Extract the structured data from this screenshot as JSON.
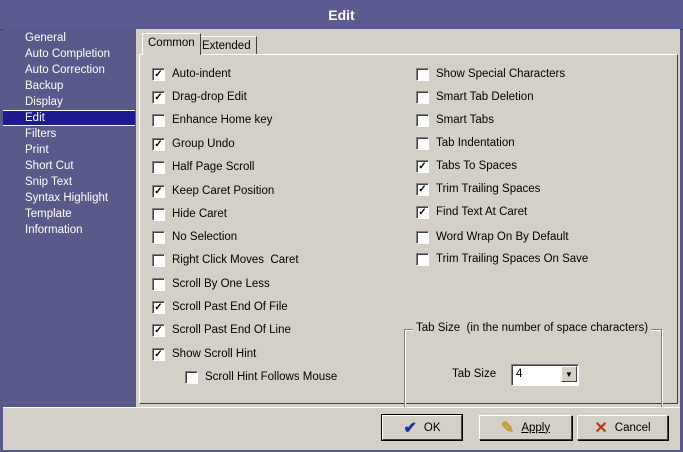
{
  "window": {
    "title": "Edit"
  },
  "sidebar": {
    "items": [
      {
        "label": "General"
      },
      {
        "label": "Auto Completion"
      },
      {
        "label": "Auto Correction"
      },
      {
        "label": "Backup"
      },
      {
        "label": "Display"
      },
      {
        "label": "Edit",
        "selected": true
      },
      {
        "label": "Filters"
      },
      {
        "label": "Print"
      },
      {
        "label": "Short Cut"
      },
      {
        "label": "Snip Text"
      },
      {
        "label": "Syntax Highlight"
      },
      {
        "label": "Template"
      },
      {
        "label": "Information"
      }
    ]
  },
  "tabs": {
    "common": "Common",
    "extended": "Extended",
    "active": "Common"
  },
  "left_options": [
    {
      "label": "Auto-indent",
      "checked": true
    },
    {
      "label": "Drag-drop Edit",
      "checked": true
    },
    {
      "label": "Enhance Home key",
      "checked": false
    },
    {
      "label": "Group Undo",
      "checked": true
    },
    {
      "label": "Half Page Scroll",
      "checked": false
    },
    {
      "label": "Keep Caret Position",
      "checked": true
    },
    {
      "label": "Hide Caret",
      "checked": false
    },
    {
      "label": "No Selection",
      "checked": false
    },
    {
      "label": "Right Click Moves  Caret",
      "checked": false
    },
    {
      "label": "Scroll By One Less",
      "checked": false
    },
    {
      "label": "Scroll Past End Of File",
      "checked": true
    },
    {
      "label": "Scroll Past End Of Line",
      "checked": true
    },
    {
      "label": "Show Scroll Hint",
      "checked": true
    },
    {
      "label": "Scroll Hint Follows Mouse",
      "checked": false
    }
  ],
  "right_options": [
    {
      "label": "Show Special Characters",
      "checked": false
    },
    {
      "label": "Smart Tab Deletion",
      "checked": false
    },
    {
      "label": "Smart Tabs",
      "checked": false
    },
    {
      "label": "Tab Indentation",
      "checked": false
    },
    {
      "label": "Tabs To Spaces",
      "checked": true
    },
    {
      "label": "Trim Trailing Spaces",
      "checked": true
    },
    {
      "label": "Find Text At Caret",
      "checked": true
    },
    {
      "label": "Word Wrap On By Default",
      "checked": false
    },
    {
      "label": "Trim Trailing Spaces On Save",
      "checked": false
    }
  ],
  "tab_size_group": {
    "title": "Tab Size  (in the number of space characters)",
    "label": "Tab Size",
    "value": "4"
  },
  "buttons": {
    "ok": "OK",
    "apply": "Apply",
    "cancel": "Cancel"
  },
  "icons": {
    "ok": "check-icon",
    "apply": "pencil-check-icon",
    "cancel": "x-icon",
    "dropdown": "chevron-down-icon"
  },
  "colors": {
    "sidebar_bg": "#5a5a8a",
    "selection": "#1d1b8f",
    "dialog_bg": "#d4d0c8",
    "ok_icon": "#1a2fa0",
    "apply_icon": "#c89a2a",
    "cancel_icon": "#b83a1a"
  }
}
